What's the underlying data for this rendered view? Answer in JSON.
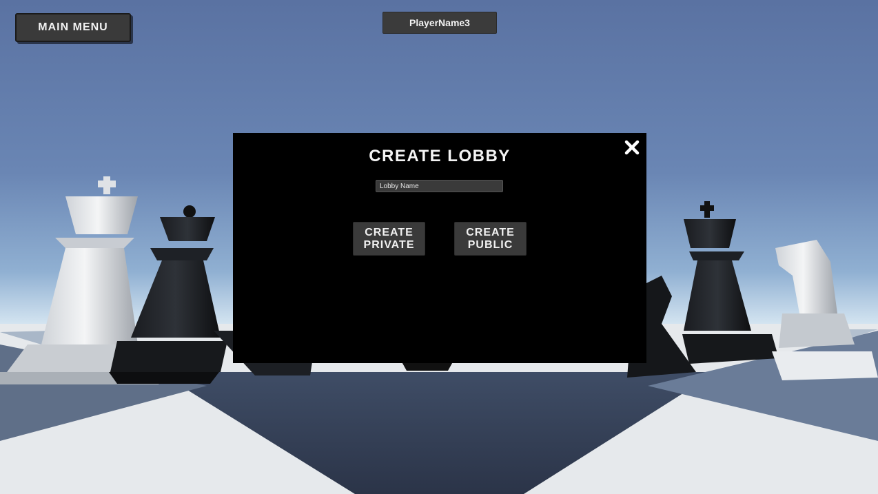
{
  "hud": {
    "main_menu_label": "MAIN MENU",
    "player_name": "PlayerName3"
  },
  "lobby_dialog": {
    "title": "CREATE LOBBY",
    "lobby_name_placeholder": "Lobby Name",
    "lobby_name_value": "",
    "create_private": {
      "line1": "CREATE",
      "line2": "PRIVATE"
    },
    "create_public": {
      "line1": "CREATE",
      "line2": "PUBLIC"
    },
    "close_icon": "close-icon"
  },
  "colors": {
    "sky_top": "#5d76a6",
    "button_bg": "#3a3a3a",
    "panel_bg": "#000000",
    "text": "#f2f2f2"
  }
}
